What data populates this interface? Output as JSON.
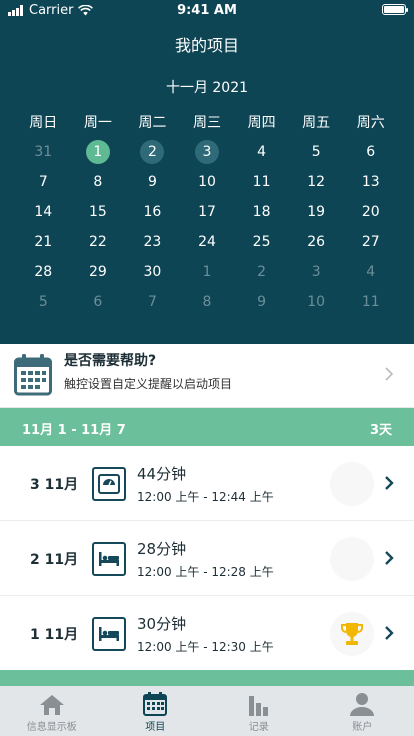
{
  "status": {
    "carrier": "Carrier",
    "time": "9:41 AM"
  },
  "header": {
    "title": "我的项目",
    "month": "十一月 2021"
  },
  "calendar": {
    "weekdays": [
      "周日",
      "周一",
      "周二",
      "周三",
      "周四",
      "周五",
      "周六"
    ],
    "weeks": [
      [
        "31",
        "1",
        "2",
        "3",
        "4",
        "5",
        "6"
      ],
      [
        "7",
        "8",
        "9",
        "10",
        "11",
        "12",
        "13"
      ],
      [
        "14",
        "15",
        "16",
        "17",
        "18",
        "19",
        "20"
      ],
      [
        "21",
        "22",
        "23",
        "24",
        "25",
        "26",
        "27"
      ],
      [
        "28",
        "29",
        "30",
        "1",
        "2",
        "3",
        "4"
      ],
      [
        "5",
        "6",
        "7",
        "8",
        "9",
        "10",
        "11"
      ]
    ]
  },
  "help": {
    "title": "是否需要帮助?",
    "subtitle": "触控设置自定义提醒以启动项目"
  },
  "week_summary": {
    "range": "11月 1 - 11月 7",
    "days": "3天"
  },
  "entries": [
    {
      "date": "3 11月",
      "duration": "44分钟",
      "range": "12:00 上午 - 12:44 上午",
      "icon": "scale-icon",
      "badge": "empty"
    },
    {
      "date": "2 11月",
      "duration": "28分钟",
      "range": "12:00 上午 - 12:28 上午",
      "icon": "bed-icon",
      "badge": "empty"
    },
    {
      "date": "1 11月",
      "duration": "30分钟",
      "range": "12:00 上午 - 12:30 上午",
      "icon": "bed-icon",
      "badge": "trophy-icon"
    }
  ],
  "tabs": [
    {
      "label": "信息显示板",
      "icon": "home-icon"
    },
    {
      "label": "项目",
      "icon": "calendar-icon",
      "active": true
    },
    {
      "label": "记录",
      "icon": "bar-chart-icon"
    },
    {
      "label": "账户",
      "icon": "person-icon"
    }
  ],
  "colors": {
    "header_bg": "#0e4554",
    "accent_green": "#6bbf9b",
    "selected_day": "#5fb993",
    "tracked_day": "#2f6a78",
    "trophy": "#f2b705"
  }
}
